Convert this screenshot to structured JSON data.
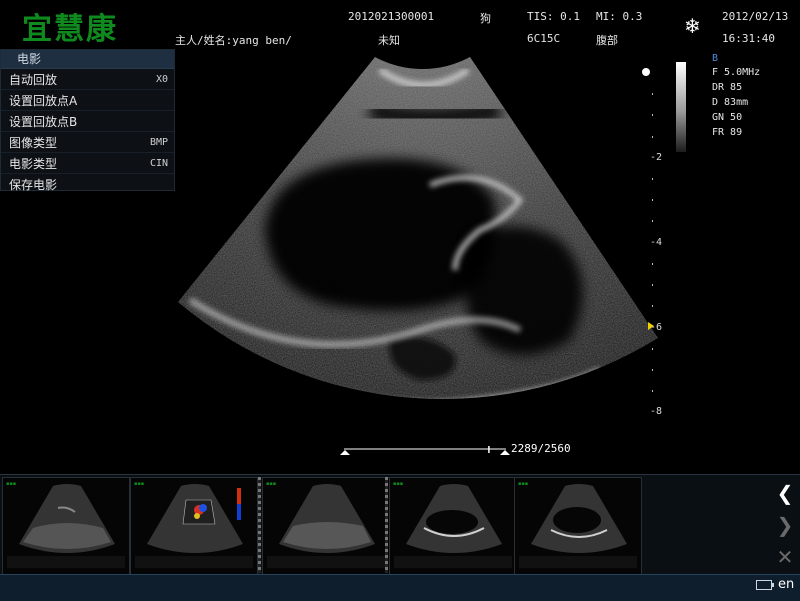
{
  "header": {
    "logo": "宜慧康",
    "patient_id": "2012021300001",
    "species": "狗",
    "tis": "TIS: 0.1",
    "mi": "MI: 0.3",
    "date": "2012/02/13",
    "owner": "主人/姓名:yang ben/",
    "unknown": "未知",
    "probe": "6C15C",
    "exam": "腹部",
    "time": "16:31:40",
    "freeze_icon": "snowflake-icon"
  },
  "cine_menu": {
    "title": "电影",
    "items": [
      {
        "label": "自动回放",
        "value": "X0"
      },
      {
        "label": "设置回放点A",
        "value": ""
      },
      {
        "label": "设置回放点B",
        "value": ""
      },
      {
        "label": "图像类型",
        "value": "BMP"
      },
      {
        "label": "电影类型",
        "value": "CIN"
      },
      {
        "label": "保存电影",
        "value": ""
      }
    ]
  },
  "params": {
    "mode": "B",
    "f": "F   5.0MHz",
    "dr": "DR  85",
    "d": "D   83mm",
    "gn": "GN  50",
    "fr": "FR  89"
  },
  "depth_scale": {
    "labels": [
      "-2",
      "-4",
      "-6",
      "-8"
    ]
  },
  "cine": {
    "frame_label": "2289/2560",
    "frame_current": 2289,
    "frame_total": 2560
  },
  "thumbnails": {
    "items": [
      {
        "kind": "b-mode-liver"
      },
      {
        "kind": "color-doppler"
      },
      {
        "kind": "b-mode-liver"
      },
      {
        "kind": "b-mode-cavity"
      },
      {
        "kind": "b-mode-cavity"
      }
    ]
  },
  "nav": {
    "prev_icon": "chevron-left-icon",
    "next_icon": "chevron-right-icon",
    "delete_icon": "close-icon"
  },
  "status": {
    "battery_icon": "battery-icon",
    "language": "en"
  },
  "colors": {
    "logo": "#0f8a1e",
    "mode_label": "#4a8ad8",
    "focus_marker": "#f5d000",
    "menu_title_bg": "#1e2f42",
    "bottom_bar": "#0f1e2c"
  }
}
